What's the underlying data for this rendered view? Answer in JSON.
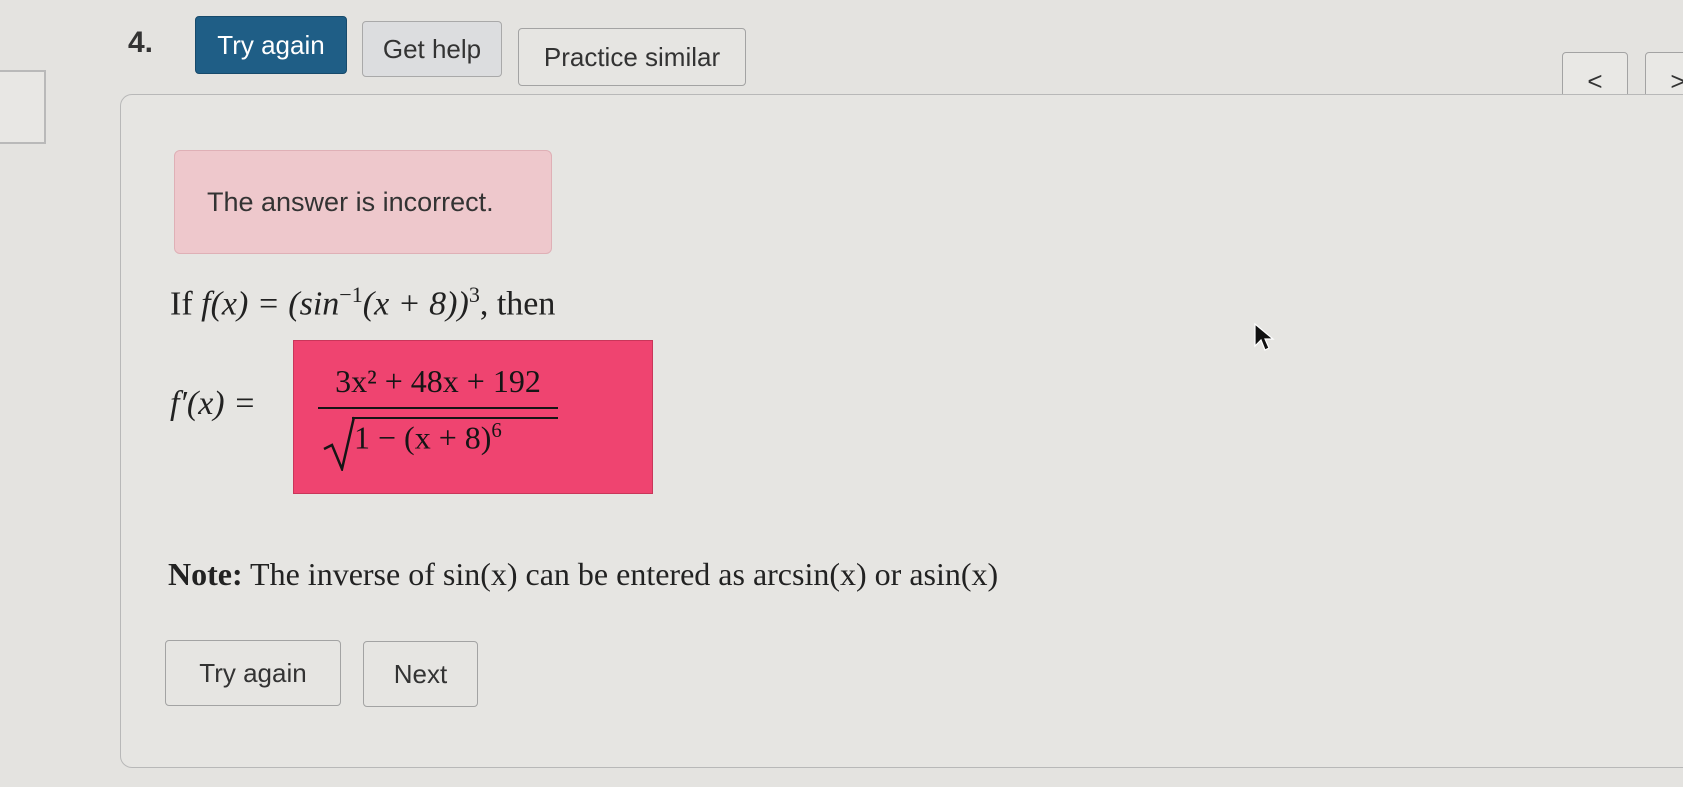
{
  "question": {
    "number": "4."
  },
  "toolbar": {
    "try_again_label": "Try again",
    "get_help_label": "Get help",
    "practice_similar_label": "Practice similar",
    "prev_label": "<",
    "next_label": ">"
  },
  "feedback": {
    "message": "The answer is incorrect."
  },
  "problem": {
    "prefix": "If ",
    "function": "f(x) = (sin",
    "inverse_exp": "−1",
    "inner": "(x + 8))",
    "power": "3",
    "suffix": ", then",
    "derivative_label": "f′(x) ="
  },
  "answer": {
    "numerator": "3x² + 48x + 192",
    "denominator_base": "1 − (x + 8)",
    "denominator_power": "6"
  },
  "note": {
    "label": "Note:",
    "text": "The inverse of sin(x) can be entered as arcsin(x) or asin(x)"
  },
  "actions": {
    "try_again_label": "Try again",
    "next_label": "Next"
  },
  "colors": {
    "primary_button": "#1f5e86",
    "alert_background": "#eec8cc",
    "incorrect_answer": "#ef4470"
  }
}
